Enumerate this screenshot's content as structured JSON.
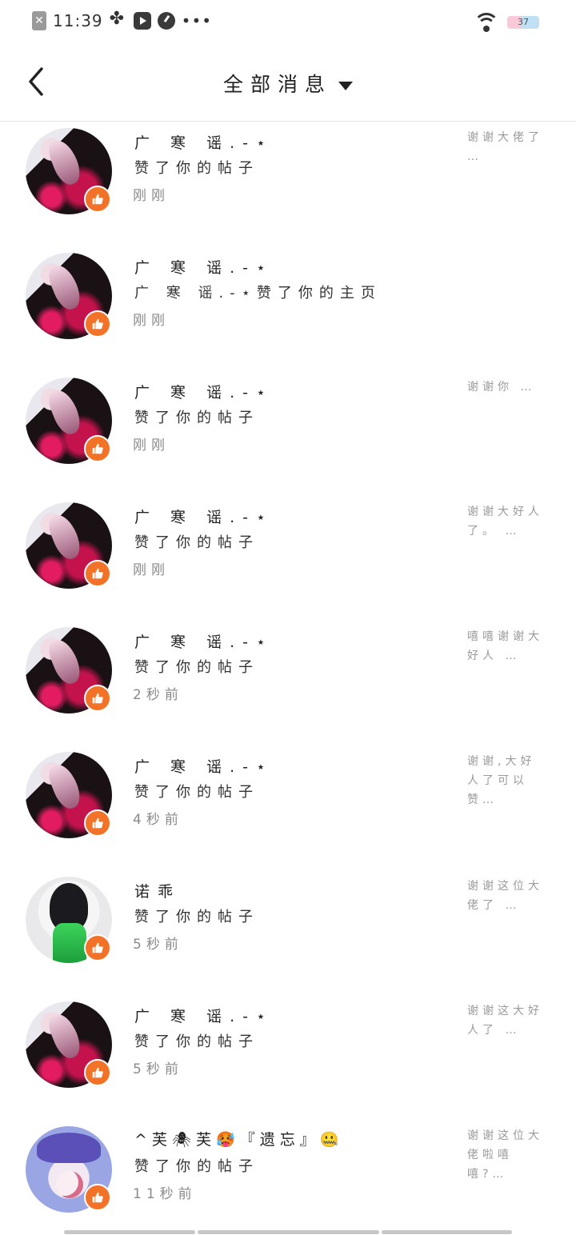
{
  "status_bar": {
    "time": "11:39",
    "dots": "•••",
    "battery": "37",
    "close_glyph": "✕"
  },
  "header": {
    "title": "全部消息"
  },
  "messages": [
    {
      "name": "广 寒 谣.-⋆",
      "action": "赞了你的帖子",
      "time": "刚刚",
      "quote": "谢谢大佬了 …",
      "avatar": "red"
    },
    {
      "name": "广 寒 谣.-⋆",
      "action": "广 寒 谣.-⋆赞了你的主页",
      "time": "刚刚",
      "quote": "",
      "avatar": "red"
    },
    {
      "name": "广 寒 谣.-⋆",
      "action": "赞了你的帖子",
      "time": "刚刚",
      "quote": "谢谢你 …",
      "avatar": "red"
    },
    {
      "name": "广 寒 谣.-⋆",
      "action": "赞了你的帖子",
      "time": "刚刚",
      "quote": "谢谢大好人了。 …",
      "avatar": "red"
    },
    {
      "name": "广 寒 谣.-⋆",
      "action": "赞了你的帖子",
      "time": "2秒前",
      "quote": "嘻嘻谢谢大好人 …",
      "avatar": "red"
    },
    {
      "name": "广 寒 谣.-⋆",
      "action": "赞了你的帖子",
      "time": "4秒前",
      "quote": "谢谢,大好人了可以赞…",
      "avatar": "red"
    },
    {
      "name": "诺乖",
      "action": "赞了你的帖子",
      "time": "5秒前",
      "quote": "谢谢这位大佬了 …",
      "avatar": "green"
    },
    {
      "name": "广 寒 谣.-⋆",
      "action": "赞了你的帖子",
      "time": "5秒前",
      "quote": "谢谢这大好人了 …",
      "avatar": "red"
    },
    {
      "name": "^芙🕷芙🥵『遗忘』🤐",
      "action": "赞了你的帖子",
      "time": "11秒前",
      "quote": "谢谢这位大佬啦嘻嘻?…",
      "avatar": "blue"
    }
  ]
}
